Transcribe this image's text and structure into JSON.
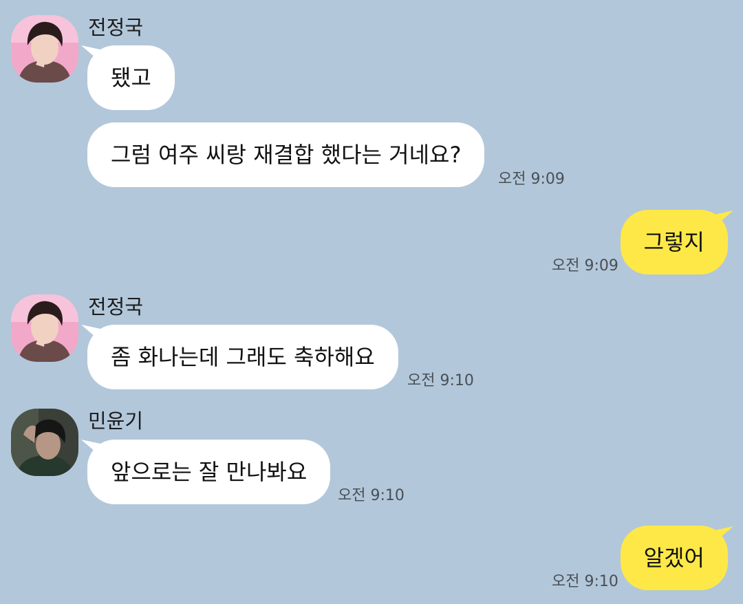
{
  "colors": {
    "background": "#b2c7da",
    "incoming_bubble": "#ffffff",
    "outgoing_bubble": "#fde847",
    "timestamp": "#4a4f55"
  },
  "messages": [
    {
      "sender": "전정국",
      "avatar": "profile-photo-jungkook",
      "text": "됐고"
    },
    {
      "text": "그럼 여주 씨랑 재결합 했다는 거네요?",
      "time": "오전 9:09"
    },
    {
      "outgoing": true,
      "text": "그렇지",
      "time": "오전 9:09"
    },
    {
      "sender": "전정국",
      "avatar": "profile-photo-jungkook",
      "text": "좀 화나는데 그래도 축하해요",
      "time": "오전 9:10"
    },
    {
      "sender": "민윤기",
      "avatar": "profile-photo-yoongi",
      "text": "앞으로는 잘 만나봐요",
      "time": "오전 9:10"
    },
    {
      "outgoing": true,
      "text": "알겠어",
      "time": "오전 9:10"
    }
  ]
}
